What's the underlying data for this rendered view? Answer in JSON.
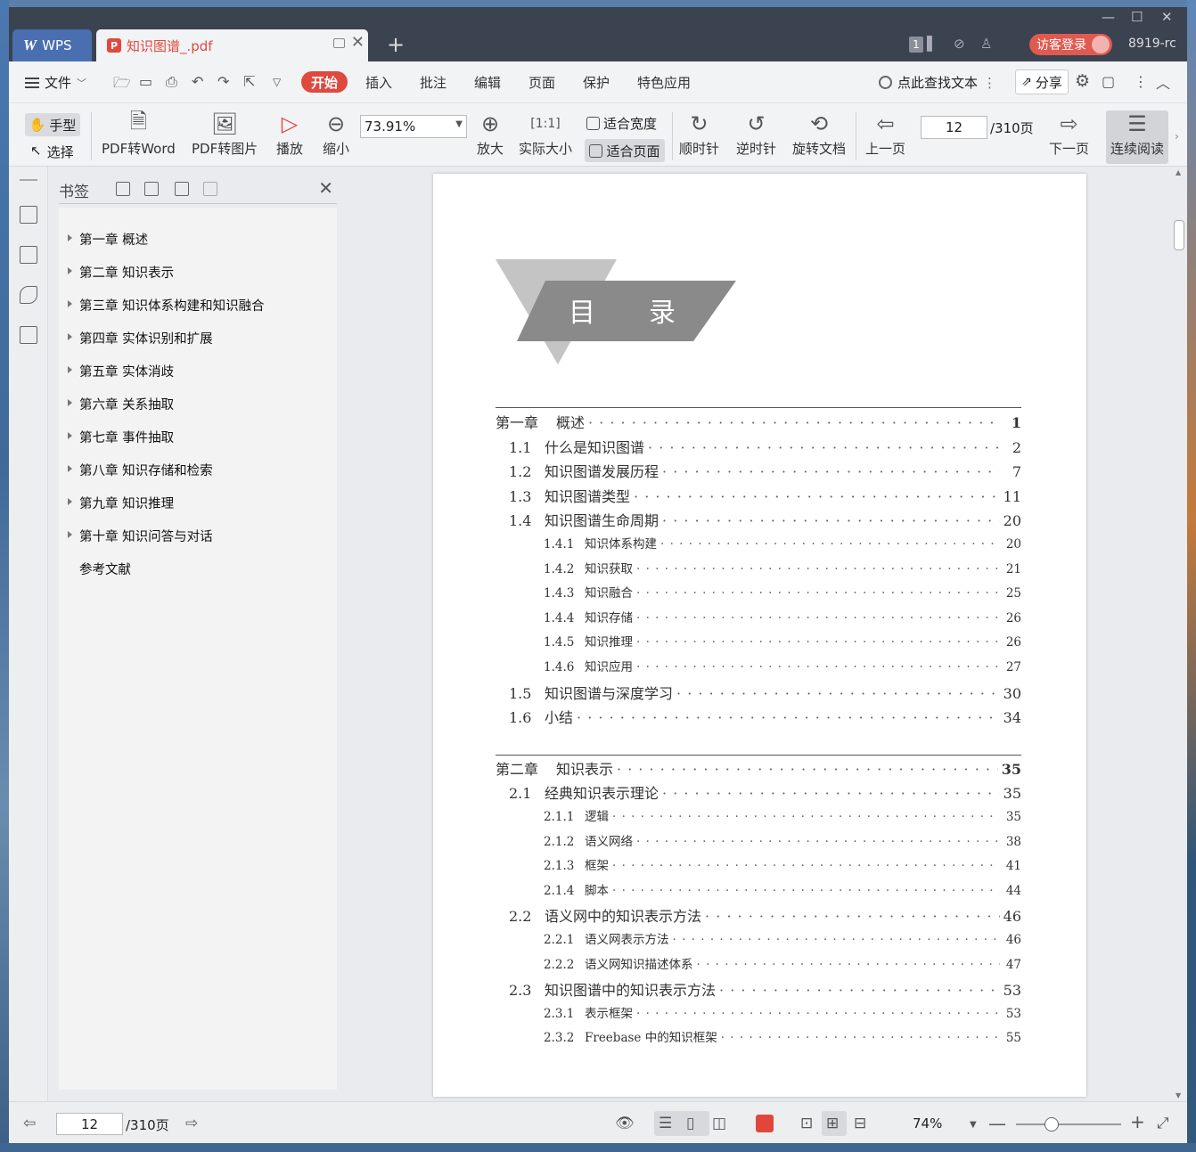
{
  "titlebar": {
    "app_tab": "WPS",
    "doc_tab": "知识图谱_.pdf",
    "page_badge": "1",
    "visitor_login": "访客登录",
    "user_code": "8919-rc"
  },
  "menubar": {
    "file": "文件",
    "items": [
      "开始",
      "插入",
      "批注",
      "编辑",
      "页面",
      "保护",
      "特色应用"
    ],
    "search_placeholder": "点此查找文本",
    "share": "分享"
  },
  "toolbar": {
    "hand": "手型",
    "select": "选择",
    "pdf_to_word": "PDF转Word",
    "pdf_to_image": "PDF转图片",
    "play": "播放",
    "zoom_out": "缩小",
    "zoom_value": "73.91%",
    "zoom_in": "放大",
    "actual_size": "实际大小",
    "fit_width": "适合宽度",
    "fit_page": "适合页面",
    "rotate_cw": "顺时针",
    "rotate_ccw": "逆时针",
    "rotate_doc": "旋转文档",
    "prev_page": "上一页",
    "current_page": "12",
    "total_pages": "/310页",
    "next_page": "下一页",
    "continuous": "连续阅读"
  },
  "panel": {
    "title": "书签",
    "bookmarks": [
      "第一章 概述",
      "第二章 知识表示",
      "第三章 知识体系构建和知识融合",
      "第四章 实体识别和扩展",
      "第五章 实体消歧",
      "第六章 关系抽取",
      "第七章 事件抽取",
      "第八章 知识存储和检索",
      "第九章 知识推理",
      "第十章 知识问答与对话",
      "参考文献"
    ]
  },
  "page": {
    "banner_title": "目　　录",
    "toc": [
      {
        "level": "chap",
        "num": "第一章",
        "title": "概述",
        "page": "1"
      },
      {
        "level": "sec",
        "num": "1.1",
        "title": "什么是知识图谱",
        "page": "2"
      },
      {
        "level": "sec",
        "num": "1.2",
        "title": "知识图谱发展历程",
        "page": "7"
      },
      {
        "level": "sec",
        "num": "1.3",
        "title": "知识图谱类型",
        "page": "11"
      },
      {
        "level": "sec",
        "num": "1.4",
        "title": "知识图谱生命周期",
        "page": "20"
      },
      {
        "level": "sub",
        "num": "1.4.1",
        "title": "知识体系构建",
        "page": "20"
      },
      {
        "level": "sub",
        "num": "1.4.2",
        "title": "知识获取",
        "page": "21"
      },
      {
        "level": "sub",
        "num": "1.4.3",
        "title": "知识融合",
        "page": "25"
      },
      {
        "level": "sub",
        "num": "1.4.4",
        "title": "知识存储",
        "page": "26"
      },
      {
        "level": "sub",
        "num": "1.4.5",
        "title": "知识推理",
        "page": "26"
      },
      {
        "level": "sub",
        "num": "1.4.6",
        "title": "知识应用",
        "page": "27"
      },
      {
        "level": "sec",
        "num": "1.5",
        "title": "知识图谱与深度学习",
        "page": "30"
      },
      {
        "level": "sec",
        "num": "1.6",
        "title": "小结",
        "page": "34"
      },
      {
        "level": "chap",
        "num": "第二章",
        "title": "知识表示",
        "page": "35"
      },
      {
        "level": "sec",
        "num": "2.1",
        "title": "经典知识表示理论",
        "page": "35"
      },
      {
        "level": "sub",
        "num": "2.1.1",
        "title": "逻辑",
        "page": "35"
      },
      {
        "level": "sub",
        "num": "2.1.2",
        "title": "语义网络",
        "page": "38"
      },
      {
        "level": "sub",
        "num": "2.1.3",
        "title": "框架",
        "page": "41"
      },
      {
        "level": "sub",
        "num": "2.1.4",
        "title": "脚本",
        "page": "44"
      },
      {
        "level": "sec",
        "num": "2.2",
        "title": "语义网中的知识表示方法",
        "page": "46"
      },
      {
        "level": "sub",
        "num": "2.2.1",
        "title": "语义网表示方法",
        "page": "46"
      },
      {
        "level": "sub",
        "num": "2.2.2",
        "title": "语义网知识描述体系",
        "page": "47"
      },
      {
        "level": "sec",
        "num": "2.3",
        "title": "知识图谱中的知识表示方法",
        "page": "53"
      },
      {
        "level": "sub",
        "num": "2.3.1",
        "title": "表示框架",
        "page": "53"
      },
      {
        "level": "sub",
        "num": "2.3.2",
        "title": "Freebase 中的知识框架",
        "page": "55"
      }
    ]
  },
  "statusbar": {
    "current_page": "12",
    "total_pages": "/310页",
    "zoom": "74%"
  }
}
